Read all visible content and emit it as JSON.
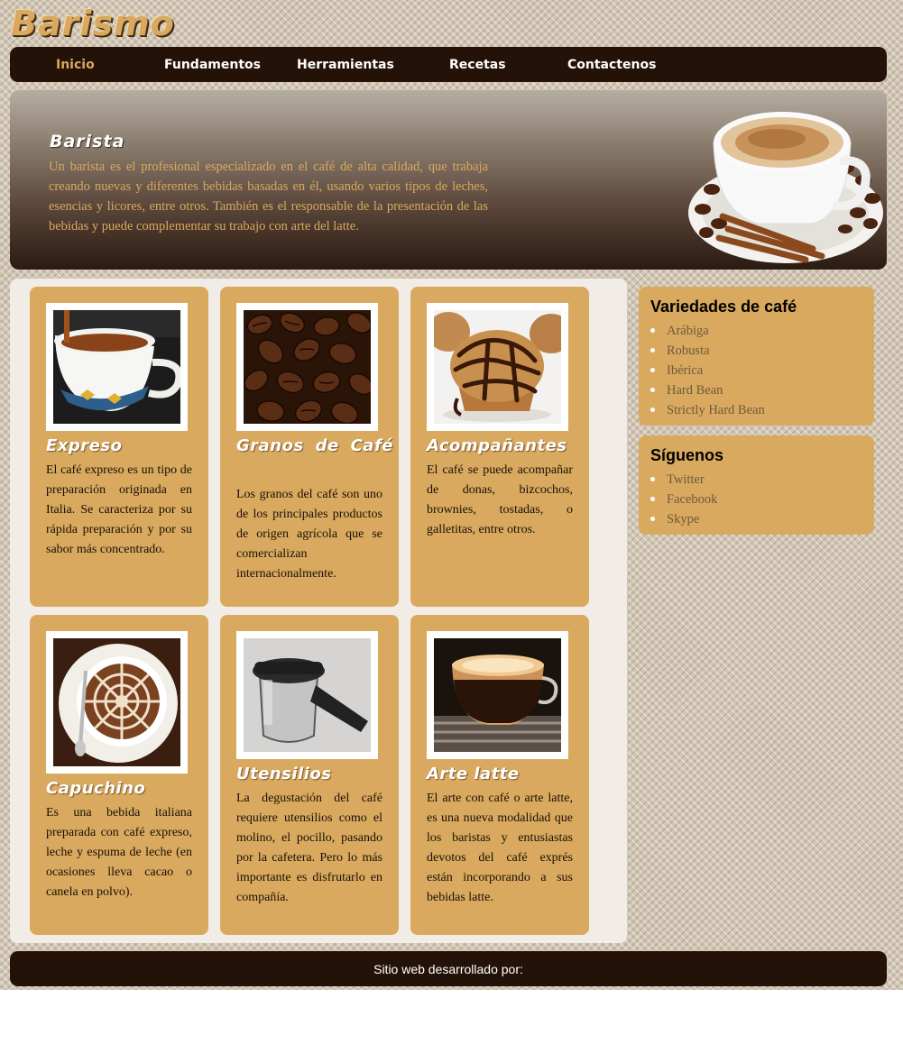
{
  "brand": {
    "logo_text": "Barismo",
    "accent": "#d8a95e",
    "dark": "#241208"
  },
  "nav": {
    "items": [
      {
        "label": "Inicio",
        "active": true
      },
      {
        "label": "Fundamentos",
        "active": false
      },
      {
        "label": "Herramientas",
        "active": false
      },
      {
        "label": "Recetas",
        "active": false
      },
      {
        "label": "Contactenos",
        "active": false
      }
    ]
  },
  "hero": {
    "title": "Barista",
    "text": "Un barista es el profesional especializado en el café de alta calidad, que trabaja creando nuevas y diferentes bebidas basadas en él, usando varios tipos de leches, esencias y licores, entre otros. También es el responsable de la presentación de las bebidas y puede complementar su trabajo con arte del latte.",
    "image": "cappuccino-cup-image"
  },
  "cards": [
    {
      "title": "Expreso",
      "image": "espresso-cup-image",
      "text": "El café expreso es un tipo de preparación originada en Italia. Se caracteriza por su rápida preparación y por su sabor más concentrado."
    },
    {
      "title": "Granos de Café",
      "image": "coffee-beans-image",
      "text": "Los granos del café son uno de los principales productos de origen agrícola que se comercializan internacionalmente."
    },
    {
      "title": "Acompañantes",
      "image": "muffin-image",
      "text": "El café se puede acompañar de donas, bizcochos, brownies, tostadas, o galletitas, entre otros."
    },
    {
      "title": "Capuchino",
      "image": "cappuccino-art-image",
      "text": "Es una bebida italiana preparada con café expreso, leche y espuma de leche (en ocasiones lleva cacao o canela en polvo)."
    },
    {
      "title": "Utensilios",
      "image": "coffee-carafe-image",
      "text": "La degustación del café requiere utensilios como el molino, el pocillo, pasando por la cafetera. Pero lo más importante es disfrutarlo en compañía."
    },
    {
      "title": "Arte latte",
      "image": "latte-glass-image",
      "text": "El arte con café o arte latte, es una nueva modalidad que los baristas y entusiastas devotos del café exprés están incorporando a sus bebidas latte."
    }
  ],
  "sidebar": {
    "varieties": {
      "title": "Variedades de café",
      "items": [
        "Arábiga",
        "Robusta",
        "Ibérica",
        "Hard Bean",
        "Strictly Hard Bean"
      ]
    },
    "follow": {
      "title": "Síguenos",
      "items": [
        "Twitter",
        "Facebook",
        "Skype"
      ]
    }
  },
  "footer": {
    "text": "Sitio web desarrollado por:"
  }
}
